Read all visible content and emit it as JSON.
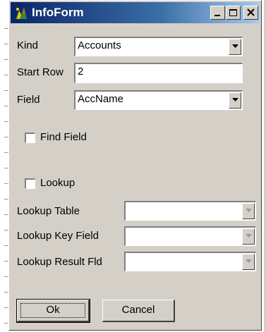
{
  "window": {
    "title": "InfoForm",
    "icon": "app-logo-icon"
  },
  "caption_buttons": {
    "minimize": "minimize-icon",
    "maximize": "maximize-icon",
    "close": "close-icon"
  },
  "form": {
    "kind": {
      "label": "Kind",
      "value": "Accounts"
    },
    "start_row": {
      "label": "Start Row",
      "value": "2"
    },
    "field": {
      "label": "Field",
      "value": "AccName"
    },
    "find_field": {
      "label": "Find Field",
      "checked": false
    },
    "lookup": {
      "label": "Lookup",
      "checked": false
    },
    "lookup_table": {
      "label": "Lookup Table",
      "value": ""
    },
    "lookup_key_field": {
      "label": "Lookup Key Field",
      "value": ""
    },
    "lookup_result_fld": {
      "label": "Lookup Result Fld",
      "value": ""
    }
  },
  "buttons": {
    "ok": "Ok",
    "cancel": "Cancel"
  },
  "colors": {
    "title_start": "#0a246a",
    "title_end": "#a6caf0",
    "face": "#d4d0c8"
  }
}
